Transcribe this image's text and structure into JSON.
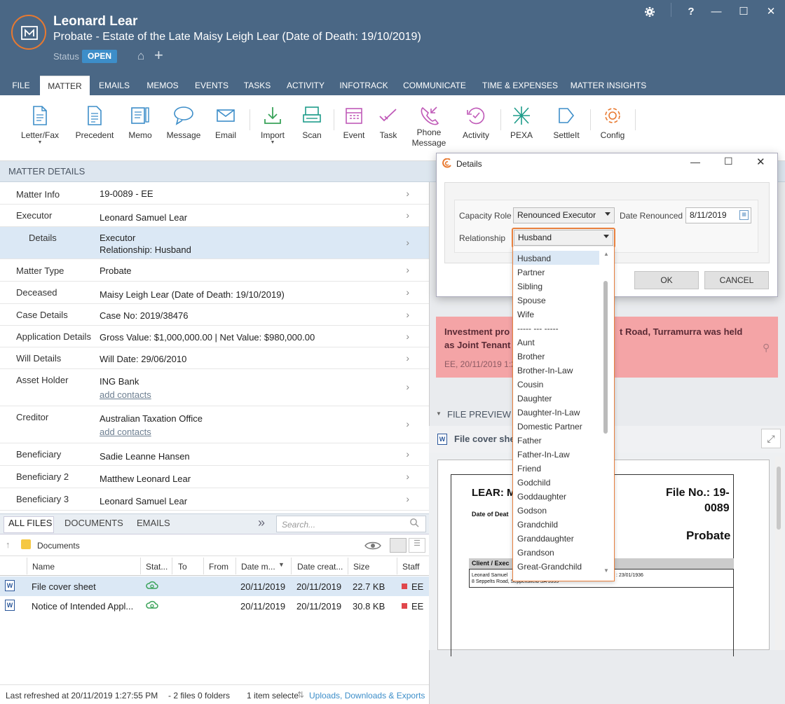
{
  "header": {
    "client_name": "Leonard Lear",
    "matter_title": "Probate - Estate of the Late Maisy Leigh Lear (Date of Death: 19/10/2019)",
    "status_label": "Status",
    "status_value": "OPEN",
    "window_buttons": [
      "?",
      "—",
      "☐",
      "✕"
    ]
  },
  "tabs": [
    "FILE",
    "MATTER",
    "EMAILS",
    "MEMOS",
    "EVENTS",
    "TASKS",
    "ACTIVITY",
    "INFOTRACK",
    "COMMUNICATE",
    "TIME & EXPENSES",
    "MATTER INSIGHTS"
  ],
  "ribbon": [
    {
      "label": "Letter/Fax",
      "icon": "letter-icon"
    },
    {
      "label": "Precedent",
      "icon": "precedent-icon"
    },
    {
      "label": "Memo",
      "icon": "memo-icon"
    },
    {
      "label": "Message",
      "icon": "message-icon"
    },
    {
      "label": "Email",
      "icon": "email-icon"
    },
    {
      "label": "Import",
      "icon": "import-icon"
    },
    {
      "label": "Scan",
      "icon": "scan-icon"
    },
    {
      "label": "Event",
      "icon": "event-icon"
    },
    {
      "label": "Task",
      "icon": "task-icon"
    },
    {
      "label": "Phone\nMessage",
      "icon": "phone-message-icon"
    },
    {
      "label": "Activity",
      "icon": "activity-icon"
    },
    {
      "label": "PEXA",
      "icon": "pexa-icon"
    },
    {
      "label": "SettleIt",
      "icon": "settleit-icon"
    },
    {
      "label": "Config",
      "icon": "config-icon"
    }
  ],
  "matter_details": {
    "header": "MATTER DETAILS",
    "rows": [
      {
        "label": "Matter Info",
        "value": "19-0089 - EE"
      },
      {
        "label": "Executor",
        "value": "Leonard Samuel Lear"
      },
      {
        "label": "Details",
        "value": "Executor",
        "value2": "Relationship: Husband"
      },
      {
        "label": "Matter Type",
        "value": "Probate"
      },
      {
        "label": "Deceased",
        "value": "Maisy Leigh Lear (Date of Death: 19/10/2019)"
      },
      {
        "label": "Case Details",
        "value": "Case No: 2019/38476"
      },
      {
        "label": "Application Details",
        "value": "Gross Value: $1,000,000.00 | Net Value: $980,000.00"
      },
      {
        "label": "Will Details",
        "value": "Will Date: 29/06/2010"
      },
      {
        "label": "Asset Holder",
        "value": "ING Bank",
        "link": "add contacts"
      },
      {
        "label": "Creditor",
        "value": "Australian Taxation Office",
        "link": "add contacts"
      },
      {
        "label": "Beneficiary",
        "value": "Sadie Leanne Hansen"
      },
      {
        "label": "Beneficiary 2",
        "value": "Matthew Leonard Lear"
      },
      {
        "label": "Beneficiary 3",
        "value": "Leonard Samuel Lear"
      }
    ]
  },
  "files": {
    "tabs": [
      "ALL FILES",
      "DOCUMENTS",
      "EMAILS"
    ],
    "search_placeholder": "Search...",
    "folder": "Documents",
    "columns": [
      "Name",
      "Stat...",
      "To",
      "From",
      "Date m...",
      "Date creat...",
      "Size",
      "Staff"
    ],
    "rows": [
      {
        "name": "File cover sheet",
        "date_modified": "20/11/2019",
        "date_created": "20/11/2019",
        "size": "22.7 KB",
        "staff": "EE"
      },
      {
        "name": "Notice of Intended Appl...",
        "date_modified": "20/11/2019",
        "date_created": "20/11/2019",
        "size": "30.8 KB",
        "staff": "EE"
      }
    ],
    "status": {
      "refreshed": "Last refreshed at 20/11/2019 1:27:55 PM",
      "counts": "- 2 files 0 folders",
      "selected": "1 item selecte",
      "uploads_link": "Uploads, Downloads & Exports"
    }
  },
  "memo": {
    "text_a": "Investment pro",
    "text_b": "t Road, Turramurra was held",
    "text_c": "as Joint Tenant",
    "meta": "EE, 20/11/2019 1:2"
  },
  "preview": {
    "header": "FILE PREVIEW",
    "file_name": "File cover she",
    "doc_title": "LEAR: M",
    "doc_subtitle": "Date of Deat",
    "file_no_a": "File No.: 19-",
    "file_no_b": "0089",
    "doc_type": "Probate",
    "table_header": "Client / Exec",
    "table_line1": "Leonard Samuel",
    "table_line2": "8 Seppelts Road, Seppeltsfield SA 5355",
    "table_date": ": 23/01/1936"
  },
  "dialog": {
    "title": "Details",
    "capacity_role_label": "Capacity Role",
    "capacity_role_value": "Renounced Executor",
    "date_renounced_label": "Date Renounced",
    "date_renounced_value": "8/11/2019",
    "relationship_label": "Relationship",
    "relationship_value": "Husband",
    "ok_label": "OK",
    "cancel_label": "CANCEL",
    "options": [
      "Husband",
      "Partner",
      "Sibling",
      "Spouse",
      "Wife",
      "----- --- -----",
      "Aunt",
      "Brother",
      "Brother-In-Law",
      "Cousin",
      "Daughter",
      "Daughter-In-Law",
      "Domestic Partner",
      "Father",
      "Father-In-Law",
      "Friend",
      "Godchild",
      "Goddaughter",
      "Godson",
      "Grandchild",
      "Granddaughter",
      "Grandson",
      "Great-Grandchild"
    ]
  },
  "colors": {
    "accent": "#e87930",
    "header": "#4a6785",
    "selection": "#dbe8f5",
    "memo": "#f4a4a6",
    "link": "#3d8ec9"
  }
}
